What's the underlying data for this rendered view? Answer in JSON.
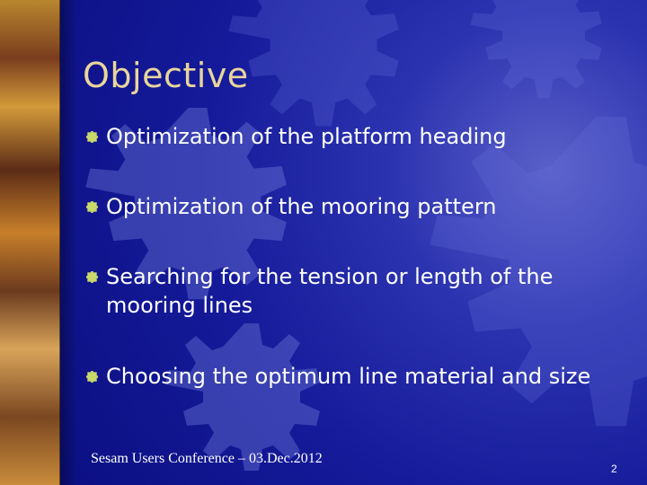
{
  "slide": {
    "title": "Objective",
    "bullets": [
      "Optimization of the platform heading",
      "Optimization of the mooring pattern",
      "Searching for the tension or length of the mooring lines",
      "Choosing the optimum line material and size"
    ],
    "footer": "Sesam Users Conference – 03.Dec.2012",
    "page_number": "2"
  },
  "colors": {
    "background": "#141a99",
    "title": "#e9d59c",
    "bullet_mark": "#c9d86a",
    "text": "#ffffff"
  },
  "icons": {
    "bullet": "gear-bullet-icon",
    "background_decoration": "gear-icon"
  }
}
